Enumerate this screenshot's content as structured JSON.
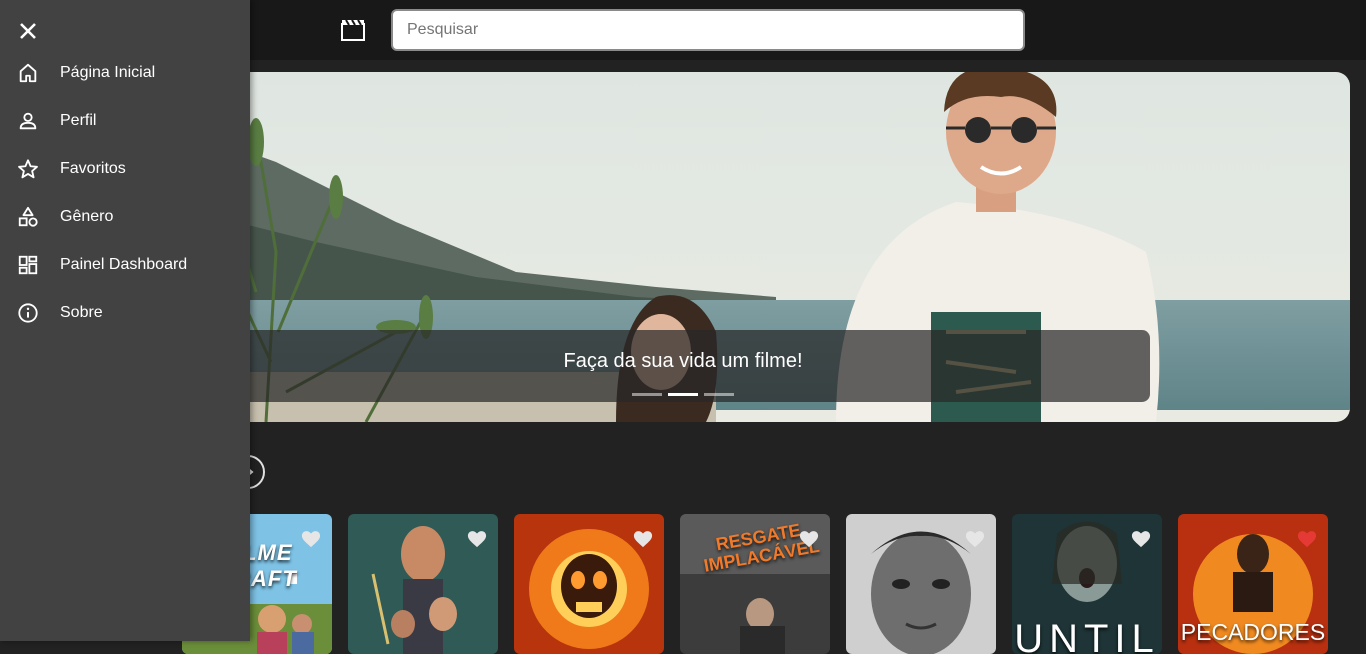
{
  "search": {
    "placeholder": "Pesquisar"
  },
  "hero": {
    "caption": "Faça da sua vida um filme!",
    "slides": 3,
    "active_slide": 2
  },
  "sidebar": {
    "items": [
      {
        "label": "Página Inicial",
        "icon": "home-icon"
      },
      {
        "label": "Perfil",
        "icon": "person-icon"
      },
      {
        "label": "Favoritos",
        "icon": "star-icon"
      },
      {
        "label": "Gênero",
        "icon": "category-shapes-icon"
      },
      {
        "label": "Painel Dashboard",
        "icon": "dashboard-icon"
      },
      {
        "label": "Sobre",
        "icon": "info-icon"
      }
    ]
  },
  "movies": [
    {
      "poster_text": "FILME CRAFT",
      "favorited": false
    },
    {
      "poster_text": "",
      "favorited": false
    },
    {
      "poster_text": "",
      "favorited": false
    },
    {
      "poster_text": "RESGATE IMPLACÁVEL",
      "favorited": false
    },
    {
      "poster_text": "",
      "favorited": false
    },
    {
      "poster_text": "UNTIL",
      "favorited": false
    },
    {
      "poster_text": "PECADORES",
      "favorited": true
    }
  ],
  "colors": {
    "heart_favorited": "#e53935",
    "heart_default": "#e6e6e6",
    "sidebar_bg": "#424242",
    "topbar_bg": "#181818",
    "page_bg": "#222222"
  }
}
